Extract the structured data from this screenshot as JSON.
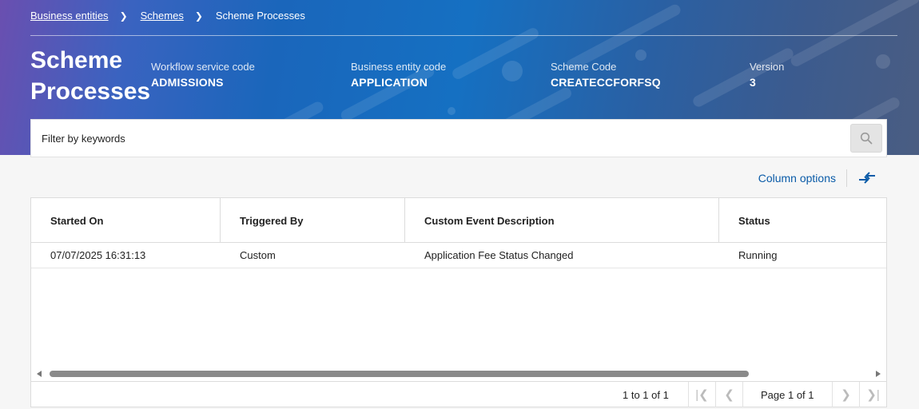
{
  "breadcrumb": {
    "items": [
      "Business entities",
      "Schemes"
    ],
    "current": "Scheme Processes"
  },
  "page": {
    "title": "Scheme Processes"
  },
  "meta": [
    {
      "label": "Workflow service code",
      "value": "ADMISSIONS"
    },
    {
      "label": "Business entity code",
      "value": "APPLICATION"
    },
    {
      "label": "Scheme Code",
      "value": "CREATECCFORFSQ"
    },
    {
      "label": "Version",
      "value": "3"
    }
  ],
  "filter": {
    "placeholder": "Filter by keywords",
    "search_icon": "search-icon"
  },
  "toolbar": {
    "column_options": "Column options",
    "toggle_icon": "swap-arrows-icon"
  },
  "table": {
    "columns": [
      "Started On",
      "Triggered By",
      "Custom Event Description",
      "Status"
    ],
    "rows": [
      [
        "07/07/2025 16:31:13",
        "Custom",
        "Application Fee Status Changed",
        "Running"
      ]
    ]
  },
  "pagination": {
    "summary": "1 to 1 of 1",
    "page_text": "Page 1 of 1"
  },
  "colors": {
    "accent": "#0a5ba8",
    "banner_start": "#6a4fb0",
    "banner_mid": "#1570c2",
    "banner_end": "#4a5d82"
  }
}
